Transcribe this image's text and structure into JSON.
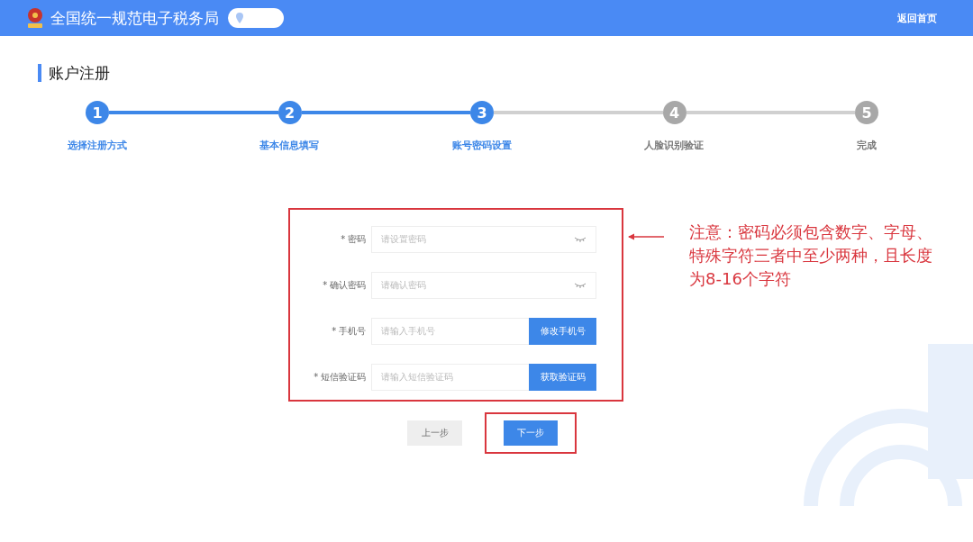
{
  "header": {
    "site_title": "全国统一规范电子税务局",
    "home_link": "返回首页"
  },
  "page_title": "账户注册",
  "steps": [
    {
      "number": "1",
      "label": "选择注册方式",
      "active": true
    },
    {
      "number": "2",
      "label": "基本信息填写",
      "active": true
    },
    {
      "number": "3",
      "label": "账号密码设置",
      "active": true
    },
    {
      "number": "4",
      "label": "人脸识别验证",
      "active": false
    },
    {
      "number": "5",
      "label": "完成",
      "active": false
    }
  ],
  "form": {
    "fields": [
      {
        "kind": "password",
        "label": "* 密码",
        "placeholder": "请设置密码"
      },
      {
        "kind": "password",
        "label": "* 确认密码",
        "placeholder": "请确认密码"
      },
      {
        "kind": "button",
        "label": "* 手机号",
        "placeholder": "请输入手机号",
        "button": "修改手机号"
      },
      {
        "kind": "button",
        "label": "* 短信验证码",
        "placeholder": "请输入短信验证码",
        "button": "获取验证码"
      }
    ]
  },
  "annotation": "注意：密码必须包含数字、字母、特殊字符三者中至少两种，且长度为8-16个字符",
  "buttons": {
    "prev": "上一步",
    "next": "下一步"
  }
}
